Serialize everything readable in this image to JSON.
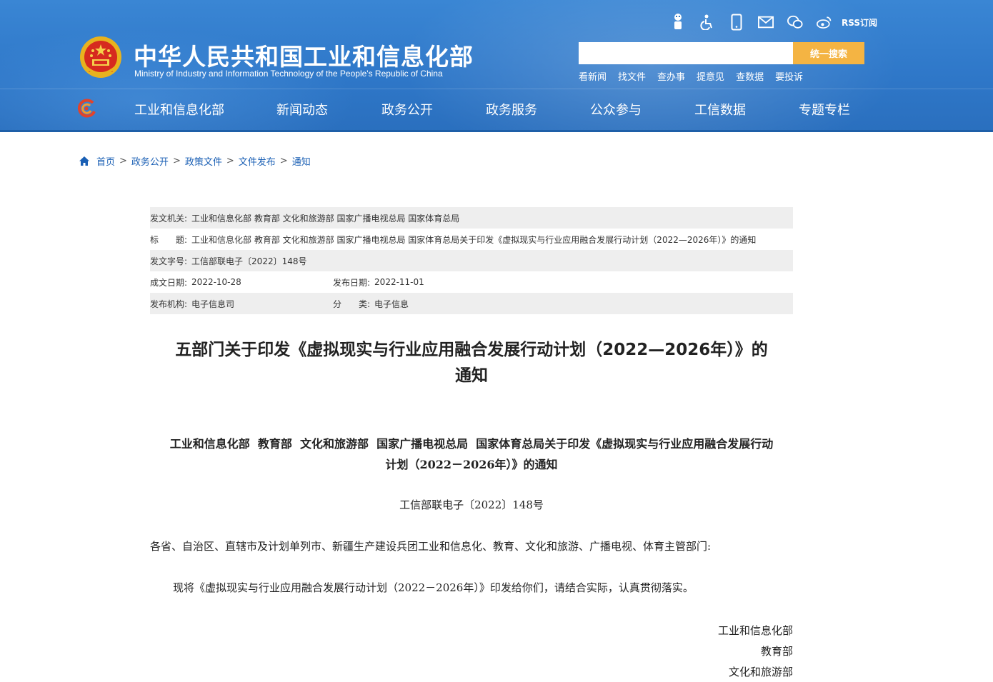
{
  "header": {
    "site_title": "中华人民共和国工业和信息化部",
    "site_subtitle": "Ministry of Industry and Information Technology of the People's Republic of China",
    "top_icons": [
      "robot-icon",
      "accessibility-icon",
      "mobile-icon",
      "mail-icon",
      "wechat-icon",
      "weibo-icon"
    ],
    "rss_label": "RSS订阅",
    "search": {
      "placeholder": "",
      "button_label": "统一搜索"
    },
    "quick_links": [
      "看新闻",
      "找文件",
      "查办事",
      "提意见",
      "查数据",
      "要投诉"
    ],
    "nav": [
      "工业和信息化部",
      "新闻动态",
      "政务公开",
      "政务服务",
      "公众参与",
      "工信数据",
      "专题专栏"
    ],
    "colors": {
      "header_blue": "#2f78c9",
      "search_button": "#f4b443",
      "link_blue": "#1a5fb4"
    }
  },
  "breadcrumb": [
    "首页",
    "政务公开",
    "政策文件",
    "文件发布",
    "通知"
  ],
  "meta": {
    "issuer_label": "发文机关:",
    "issuer": "工业和信息化部 教育部 文化和旅游部 国家广播电视总局 国家体育总局",
    "title_label": "标　　题:",
    "title": "工业和信息化部 教育部 文化和旅游部 国家广播电视总局 国家体育总局关于印发《虚拟现实与行业应用融合发展行动计划（2022—2026年）》的通知",
    "docno_label": "发文字号:",
    "docno": "工信部联电子〔2022〕148号",
    "created_label": "成文日期:",
    "created": "2022-10-28",
    "published_label": "发布日期:",
    "published": "2022-11-01",
    "org_label": "发布机构:",
    "org": "电子信息司",
    "category_label": "分　　类:",
    "category": "电子信息"
  },
  "article": {
    "title_line1": "五部门关于印发《虚拟现实与行业应用融合发展行动计划（2022—2026年）》的",
    "title_line2": "通知",
    "heading_line1": "工业和信息化部  教育部  文化和旅游部  国家广播电视总局  国家体育总局关于印发《虚拟现实与行业应用融合发展行动",
    "heading_line2": "计划（2022－2026年）》的通知",
    "doc_number": "工信部联电子〔2022〕148号",
    "addressee": "各省、自治区、直辖市及计划单列市、新疆生产建设兵团工业和信息化、教育、文化和旅游、广播电视、体育主管部门:",
    "body": "现将《虚拟现实与行业应用融合发展行动计划（2022－2026年）》印发给你们，请结合实际，认真贯彻落实。",
    "signers": [
      "工业和信息化部",
      "教育部",
      "文化和旅游部"
    ]
  }
}
